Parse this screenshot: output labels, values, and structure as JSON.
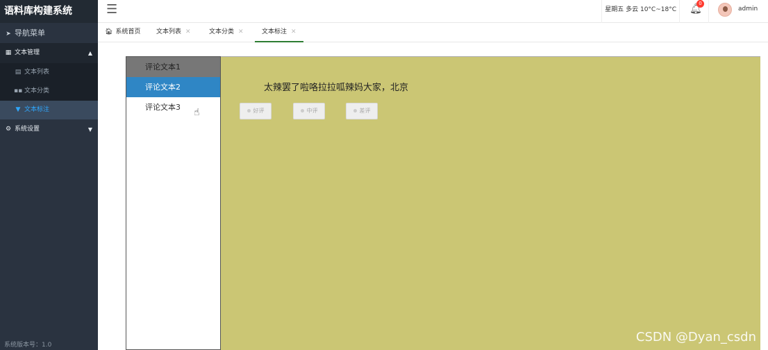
{
  "app": {
    "title": "语料库构建系统",
    "version": "系统版本号：1.0"
  },
  "sidebar": {
    "nav_label": "导航菜单",
    "groups": [
      {
        "label": "文本管理",
        "expanded": true,
        "items": [
          {
            "label": "文本列表",
            "active": false
          },
          {
            "label": "文本分类",
            "active": false
          },
          {
            "label": "文本标注",
            "active": true
          }
        ]
      },
      {
        "label": "系统设置",
        "expanded": false
      }
    ]
  },
  "topbar": {
    "weather": "星期五 多云 10°C~18°C",
    "notification_count": "0",
    "username": "admin"
  },
  "tabs": [
    {
      "label": "系统首页",
      "closable": false,
      "active": false
    },
    {
      "label": "文本列表",
      "closable": true,
      "active": false
    },
    {
      "label": "文本分类",
      "closable": true,
      "active": false
    },
    {
      "label": "文本标注",
      "closable": true,
      "active": true
    }
  ],
  "annotation": {
    "texts": [
      "评论文本1",
      "评论文本2",
      "评论文本3"
    ],
    "selected_index": 1,
    "current_text": "太辣罢了啦咯拉拉呱辣妈大家，北京",
    "labels": [
      "好评",
      "中评",
      "差评"
    ]
  },
  "watermark": "CSDN @Dyan_csdn",
  "colors": {
    "sidebar_bg": "#2a3340",
    "active_blue": "#2fa8ff",
    "selected_item": "#2f86c5",
    "text_panel_bg": "#cbc674",
    "tab_active_underline": "#2e7d32",
    "badge_red": "#ff3b30"
  },
  "icons": {
    "nav": "navigation-arrow-icon",
    "group_text": "grid-icon",
    "item_list": "table-icon",
    "item_category": "tiles-icon",
    "item_annotate": "filter-icon",
    "group_settings": "gear-icon",
    "home": "home-icon",
    "bell": "bell-icon",
    "menu": "hamburger-icon"
  }
}
